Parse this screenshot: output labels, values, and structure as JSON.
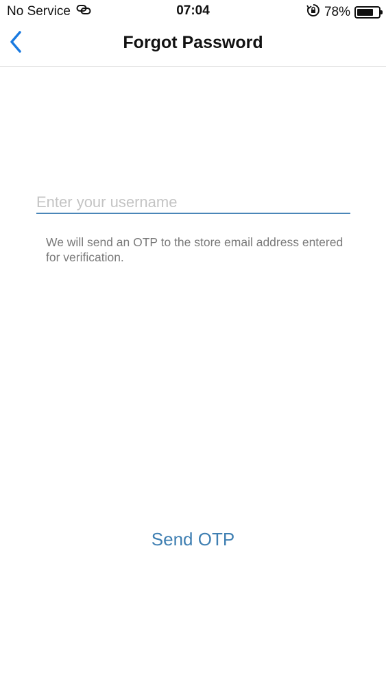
{
  "status_bar": {
    "carrier": "No Service",
    "time": "07:04",
    "battery_percent": "78%",
    "battery_level": 0.78,
    "icons": [
      "wifi-link-icon",
      "rotation-lock-icon",
      "battery-icon"
    ]
  },
  "nav": {
    "title": "Forgot Password",
    "back_icon": "chevron-left-icon"
  },
  "form": {
    "username_placeholder": "Enter your username",
    "username_value": "",
    "help_text": "We will send an OTP to the store email address entered for verification.",
    "submit_label": "Send OTP"
  },
  "colors": {
    "accent": "#3f7fb2",
    "back_icon": "#1a7ae0",
    "input_underline": "#4a86b8",
    "help_text": "#7a7a7a",
    "placeholder": "#c4c4c4"
  }
}
